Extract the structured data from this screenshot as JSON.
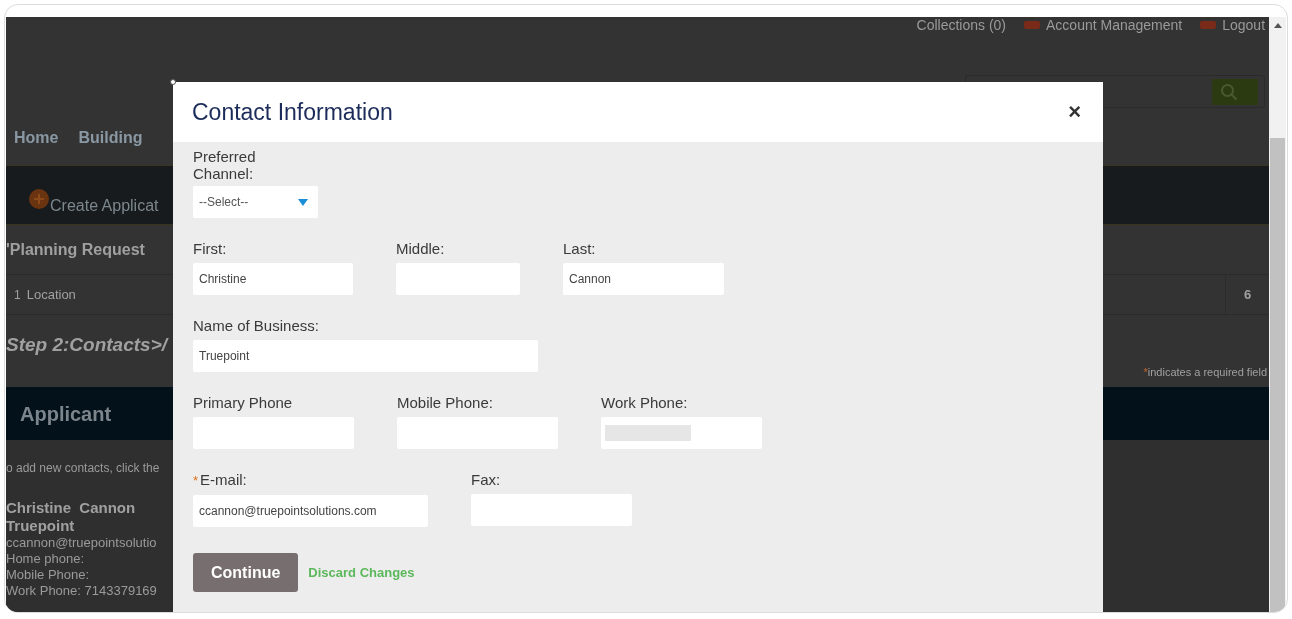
{
  "header_links": [
    {
      "label": "Collections (0)",
      "icon": false
    },
    {
      "label": "Account Management",
      "icon": true
    },
    {
      "label": "Logout",
      "icon": true
    }
  ],
  "nav": [
    {
      "label": "Home"
    },
    {
      "label": "Building"
    }
  ],
  "create_button": "Create Applicat",
  "section_title": "'Planning Request",
  "step_row": {
    "number": "1",
    "label": "Location",
    "column_3": "6"
  },
  "step_heading": "Step 2:Contacts>/",
  "required_note": {
    "mark": "*",
    "text": "indicates a required field"
  },
  "applicant_heading": "Applicant",
  "contact_hint": "o add new contacts, click the",
  "contact_card": {
    "name": "Christine  Cannon",
    "business": "Truepoint",
    "lines": [
      "ccannon@truepointsolutio",
      "Home phone:",
      "Mobile Phone:",
      "Work Phone: 7143379169"
    ]
  },
  "dialog": {
    "title": "Contact Information",
    "close": "×",
    "rows": [
      [
        {
          "kind": "select",
          "label": "Preferred Channel:",
          "value": "--Select--",
          "required": false
        }
      ],
      [
        {
          "kind": "text",
          "label": "First:",
          "value": "Christine",
          "required": false,
          "masked": false
        },
        {
          "kind": "text",
          "label": "Middle:",
          "required": false,
          "masked": false
        },
        {
          "kind": "text",
          "label": "Last:",
          "value": "Cannon",
          "required": false,
          "masked": false
        }
      ],
      [
        {
          "kind": "text",
          "label": "Name of Business:",
          "value": "Truepoint",
          "required": false,
          "masked": false
        }
      ],
      [
        {
          "kind": "text",
          "label": "Primary Phone",
          "required": false,
          "masked": false
        },
        {
          "kind": "text",
          "label": "Mobile Phone:",
          "required": false,
          "masked": false
        },
        {
          "kind": "text",
          "label": "Work Phone:",
          "required": false,
          "masked": true
        }
      ],
      [
        {
          "kind": "text",
          "label": "E-mail:",
          "value": "ccannon@truepointsolutions.com",
          "required": true,
          "masked": false
        },
        {
          "kind": "text",
          "label": "Fax:",
          "required": false,
          "masked": false
        }
      ]
    ],
    "required_mark": "*",
    "primary_button": "Continue",
    "secondary_link": "Discard Changes"
  }
}
